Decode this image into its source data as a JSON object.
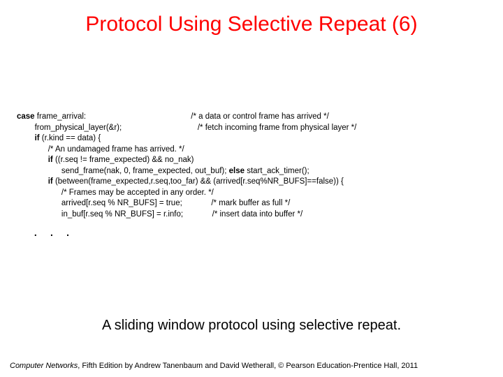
{
  "title": "Protocol Using Selective Repeat (6)",
  "code": {
    "l1a": "case",
    "l1b": " frame_arrival:",
    "c1": "/* a data or control frame has arrived */",
    "l2": "from_physical_layer(&r);",
    "c2": "/* fetch incoming frame from physical layer */",
    "l3a": "if",
    "l3b": " (r.kind == data) {",
    "c4": "/* An undamaged frame has arrived. */",
    "l5a": "if",
    "l5b": " ((r.seq != frame_expected) && no_nak)",
    "l6a": "send_frame(nak, 0, frame_expected, out_buf); ",
    "l6b": "else",
    "l6c": " start_ack_timer();",
    "l7a": "if",
    "l7b": " (between(frame_expected,r.seq,too_far) && (arrived[r.seq%NR_BUFS]==false)) {",
    "c8": "/* Frames may be accepted in any order. */",
    "l9": "arrived[r.seq % NR_BUFS] = true;",
    "c9": "/* mark buffer as full */",
    "l10": "in_buf[r.seq % NR_BUFS] = r.info;",
    "c10": "/* insert data into buffer */"
  },
  "ellipsis": ". . .",
  "caption": "A sliding window protocol using selective repeat.",
  "footer": {
    "book": "Computer Networks",
    "rest": ", Fifth Edition by Andrew Tanenbaum and David Wetherall, © Pearson Education-Prentice Hall, 2011"
  }
}
